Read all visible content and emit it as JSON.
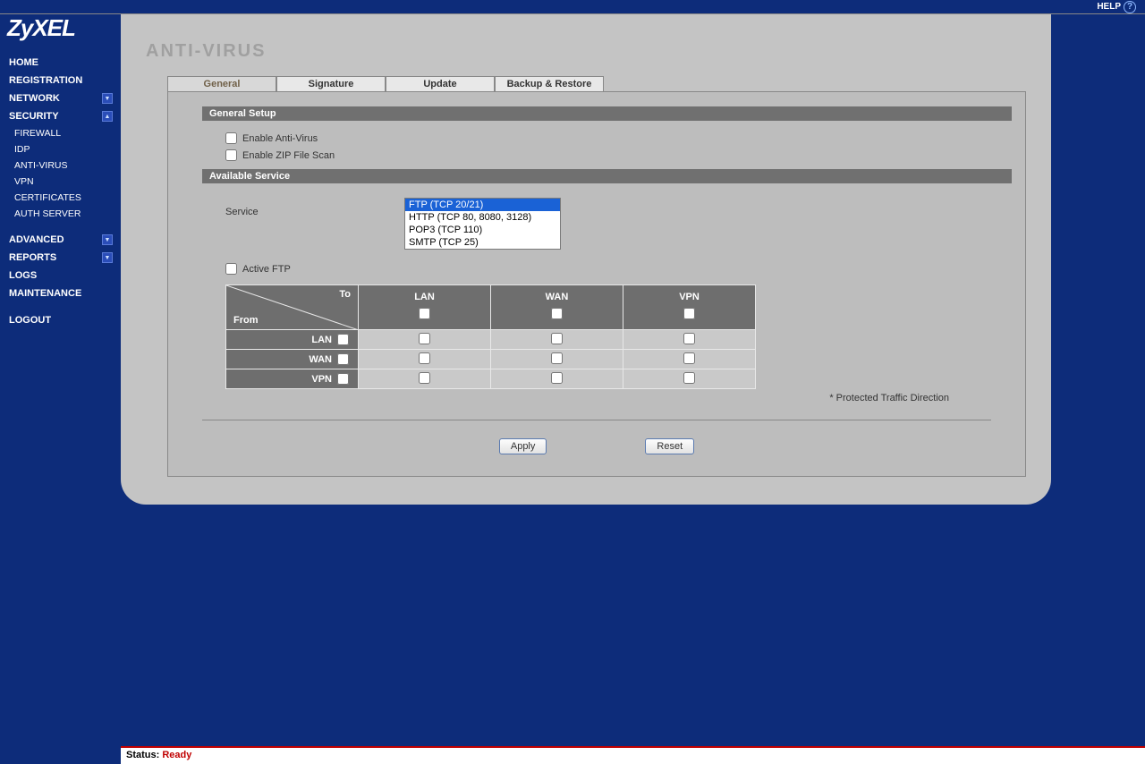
{
  "brand": "ZyXEL",
  "help": {
    "label": "HELP",
    "icon": "?"
  },
  "sidebar": {
    "items": [
      {
        "label": "HOME",
        "type": "item"
      },
      {
        "label": "REGISTRATION",
        "type": "item"
      },
      {
        "label": "NETWORK",
        "type": "item",
        "icon": "expand"
      },
      {
        "label": "SECURITY",
        "type": "item",
        "icon": "collapse",
        "children": [
          {
            "label": "FIREWALL"
          },
          {
            "label": "IDP"
          },
          {
            "label": "ANTI-VIRUS"
          },
          {
            "label": "VPN"
          },
          {
            "label": "CERTIFICATES"
          },
          {
            "label": "AUTH SERVER"
          }
        ]
      },
      {
        "label": "ADVANCED",
        "type": "item",
        "icon": "expand",
        "gapBefore": true
      },
      {
        "label": "REPORTS",
        "type": "item",
        "icon": "expand"
      },
      {
        "label": "LOGS",
        "type": "item"
      },
      {
        "label": "MAINTENANCE",
        "type": "item"
      },
      {
        "label": "LOGOUT",
        "type": "item",
        "gapBefore": true
      }
    ]
  },
  "page": {
    "title": "ANTI-VIRUS",
    "tabs": [
      "General",
      "Signature",
      "Update",
      "Backup & Restore"
    ],
    "activeTab": 0
  },
  "general": {
    "section1": "General Setup",
    "enableAV": "Enable Anti-Virus",
    "enableZip": "Enable ZIP File Scan",
    "section2": "Available Service",
    "serviceLabel": "Service",
    "serviceOptions": [
      "FTP (TCP 20/21)",
      "HTTP (TCP 80, 8080, 3128)",
      "POP3 (TCP 110)",
      "SMTP (TCP 25)"
    ],
    "serviceSelected": 0,
    "activeFtp": "Active FTP",
    "matrix": {
      "to": "To",
      "from": "From",
      "cols": [
        "LAN",
        "WAN",
        "VPN"
      ],
      "rows": [
        "LAN",
        "WAN",
        "VPN"
      ]
    },
    "footnote": "* Protected Traffic Direction",
    "applyBtn": "Apply",
    "resetBtn": "Reset"
  },
  "status": {
    "label": "Status:",
    "value": "Ready"
  }
}
